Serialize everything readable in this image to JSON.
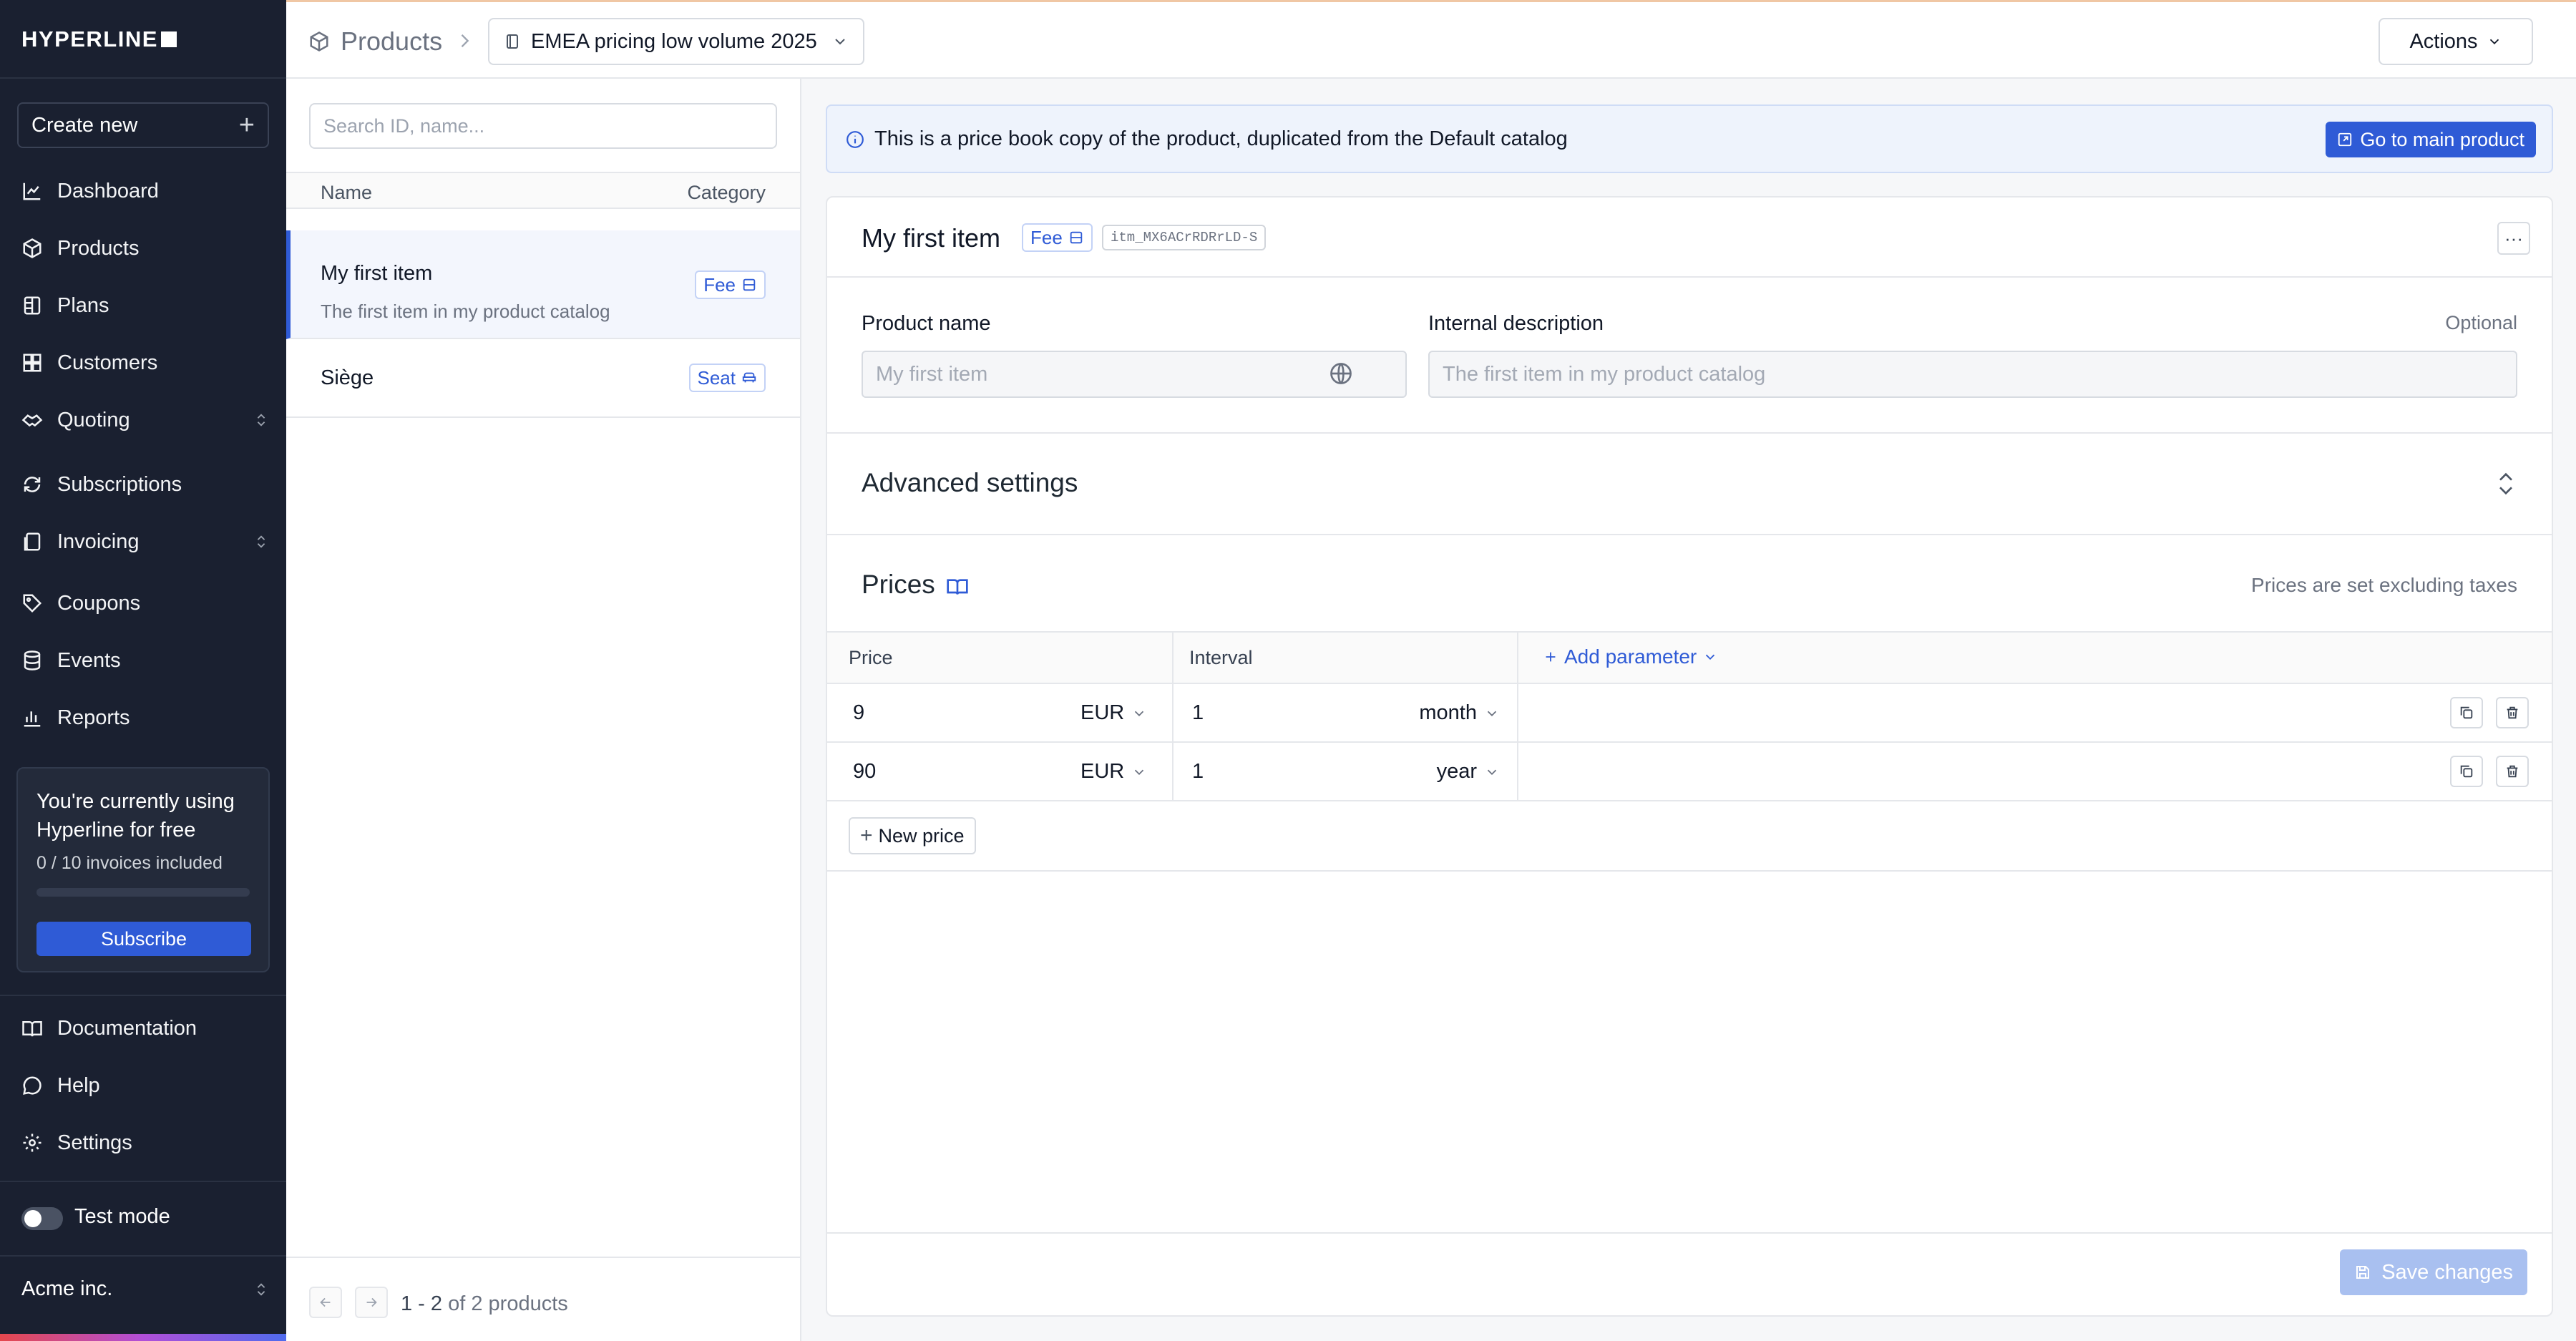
{
  "sidebar": {
    "logo": "HYPERLINE",
    "create_new": "Create new",
    "nav": {
      "dashboard": "Dashboard",
      "products": "Products",
      "plans": "Plans",
      "customers": "Customers",
      "quoting": "Quoting",
      "subscriptions": "Subscriptions",
      "invoicing": "Invoicing",
      "coupons": "Coupons",
      "events": "Events",
      "reports": "Reports",
      "documentation": "Documentation",
      "help": "Help",
      "settings": "Settings"
    },
    "promo": {
      "title": "You're currently using Hyperline for free",
      "usage": "0 / 10 invoices included",
      "usage_fraction": 0,
      "subscribe": "Subscribe"
    },
    "test_mode": "Test mode",
    "org": "Acme inc."
  },
  "topbar": {
    "breadcrumb_root": "Products",
    "price_book": "EMEA pricing low volume 2025",
    "actions": "Actions"
  },
  "list": {
    "search_placeholder": "Search ID, name...",
    "col_name": "Name",
    "col_category": "Category",
    "items": [
      {
        "name": "My first item",
        "description": "The first item in my product catalog",
        "category": "Fee"
      },
      {
        "name": "Siège",
        "description": "",
        "category": "Seat"
      }
    ],
    "pagination": {
      "range": "1 - 2",
      "of": "of",
      "total": "2 products"
    }
  },
  "banner": {
    "text": "This is a price book copy of the product, duplicated from the Default catalog",
    "button": "Go to main product"
  },
  "product": {
    "title": "My first item",
    "badge": "Fee",
    "id": "itm_MX6ACrRDRrLD-S",
    "name_label": "Product name",
    "name_placeholder": "My first item",
    "desc_label": "Internal description",
    "desc_optional": "Optional",
    "desc_placeholder": "The first item in my product catalog",
    "advanced": "Advanced settings",
    "prices_title": "Prices",
    "prices_note": "Prices are set excluding taxes",
    "col_price": "Price",
    "col_interval": "Interval",
    "add_parameter": "Add parameter",
    "prices": [
      {
        "amount": "9",
        "currency": "EUR",
        "count": "1",
        "interval": "month"
      },
      {
        "amount": "90",
        "currency": "EUR",
        "count": "1",
        "interval": "year"
      }
    ],
    "new_price": "New price",
    "save": "Save changes"
  },
  "colors": {
    "accent": "#2f5bd6",
    "sidebar_bg": "#1a2030"
  }
}
